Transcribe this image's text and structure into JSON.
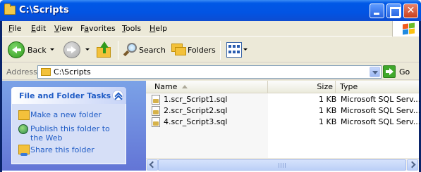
{
  "window": {
    "title": "C:\\Scripts"
  },
  "menu": [
    {
      "label": "File",
      "ul": "F",
      "rest": "ile"
    },
    {
      "label": "Edit",
      "ul": "E",
      "rest": "dit"
    },
    {
      "label": "View",
      "ul": "V",
      "rest": "iew"
    },
    {
      "label": "Favorites",
      "ul": "F",
      "rest": "avorites",
      "pre": "F",
      "mid": "a"
    },
    {
      "label": "Tools",
      "ul": "T",
      "rest": "ools"
    },
    {
      "label": "Help",
      "ul": "H",
      "rest": "elp"
    }
  ],
  "toolbar": {
    "back_label": "Back",
    "search_label": "Search",
    "folders_label": "Folders"
  },
  "address": {
    "label": "Address",
    "value": "C:\\Scripts",
    "go_label": "Go"
  },
  "tasks": {
    "title": "File and Folder Tasks",
    "items": [
      {
        "label": "Make a new folder",
        "icon": "new-folder-icon"
      },
      {
        "label_line1": "Publish this folder to",
        "label_line2": "the Web",
        "icon": "globe-icon"
      },
      {
        "label": "Share this folder",
        "icon": "share-folder-icon"
      }
    ]
  },
  "files": {
    "columns": [
      "Name",
      "Size",
      "Type"
    ],
    "rows": [
      {
        "name": "1.scr_Script1.sql",
        "size": "1 KB",
        "type": "Microsoft SQL Serv..."
      },
      {
        "name": "2.scr_Script2.sql",
        "size": "1 KB",
        "type": "Microsoft SQL Serv..."
      },
      {
        "name": "4.scr_Script3.sql",
        "size": "1 KB",
        "type": "Microsoft SQL Serv..."
      }
    ]
  }
}
